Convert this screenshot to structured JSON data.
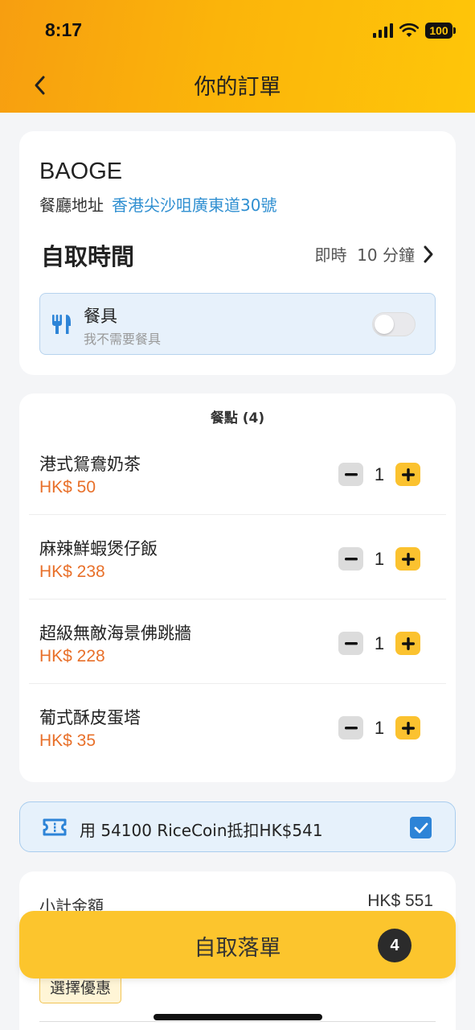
{
  "status_bar": {
    "time": "8:17",
    "battery": "100"
  },
  "header": {
    "title": "你的訂單"
  },
  "store": {
    "name": "BAOGE",
    "address_label": "餐廳地址",
    "address": "香港尖沙咀廣東道30號",
    "pickup_label": "自取時間",
    "pickup_time": "即時  10 分鐘",
    "utensils_title": "餐具",
    "utensils_subtitle": "我不需要餐具",
    "utensils_toggle_on": false
  },
  "items": {
    "title": "餐點 (4)",
    "list": [
      {
        "name": "港式鴛鴦奶茶",
        "price": "HK$ 50",
        "qty": "1"
      },
      {
        "name": "麻辣鮮蝦煲仔飯",
        "price": "HK$ 238",
        "qty": "1"
      },
      {
        "name": "超級無敵海景佛跳牆",
        "price": "HK$ 228",
        "qty": "1"
      },
      {
        "name": "葡式酥皮蛋塔",
        "price": "HK$ 35",
        "qty": "1"
      }
    ]
  },
  "ricecoin": {
    "text": "用 54100 RiceCoin抵扣HK$541",
    "checked": true
  },
  "summary": {
    "subtotal_label": "小計金額",
    "subtotal_value": "HK$ 551",
    "offer_button": "選擇優惠"
  },
  "order_button": {
    "label": "自取落單",
    "badge": "4"
  },
  "colors": {
    "accent_yellow": "#fcc52d",
    "price_orange": "#e8702a",
    "link_blue": "#2f8fd1",
    "checkbox_blue": "#2d84d7"
  }
}
